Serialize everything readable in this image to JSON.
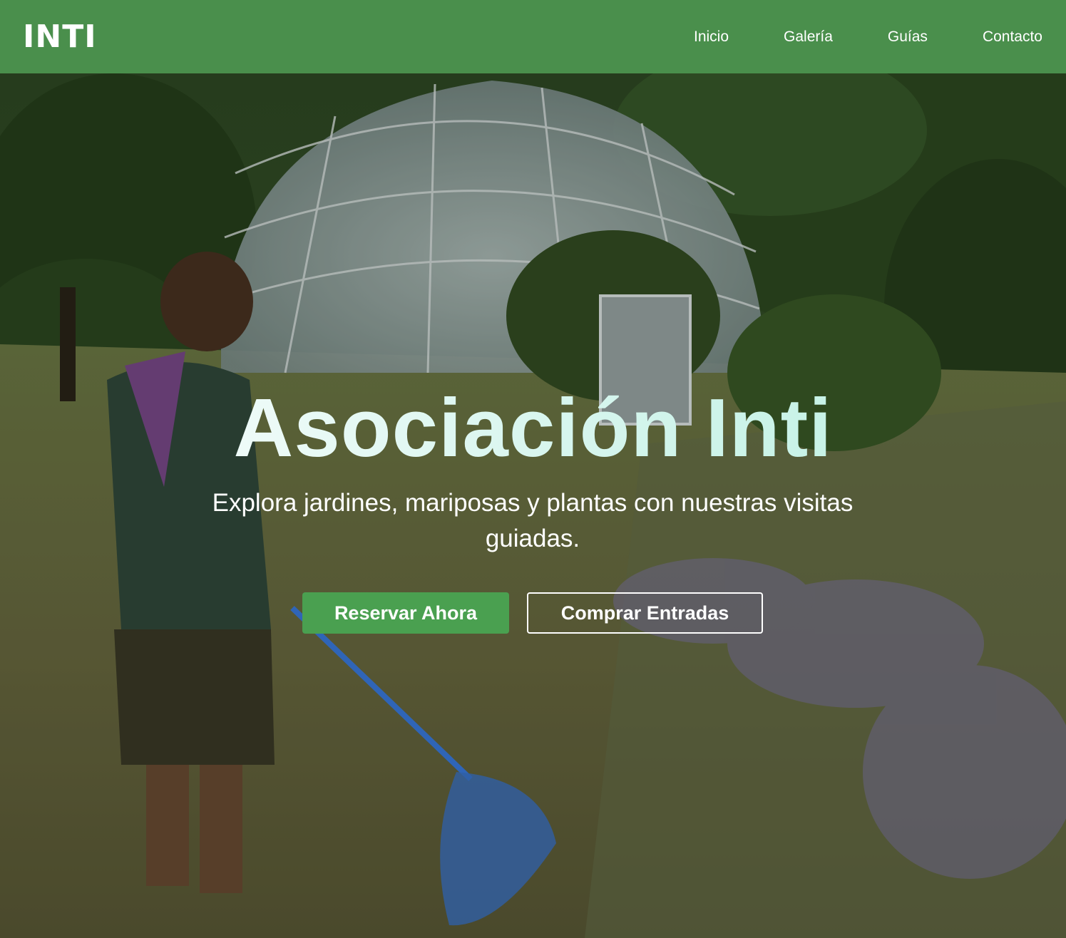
{
  "brand": {
    "logo": "INTI",
    "primary_color": "#4a8f4c",
    "button_color": "#4aa050"
  },
  "nav": {
    "items": [
      {
        "label": "Inicio"
      },
      {
        "label": "Galería"
      },
      {
        "label": "Guías"
      },
      {
        "label": "Contacto"
      }
    ]
  },
  "hero": {
    "title": "Asociación Inti",
    "subtitle": "Explora jardines, mariposas y plantas con nuestras visitas guiadas.",
    "primary_button": "Reservar Ahora",
    "secondary_button": "Comprar Entradas",
    "background_description_icon": "garden-photo"
  }
}
